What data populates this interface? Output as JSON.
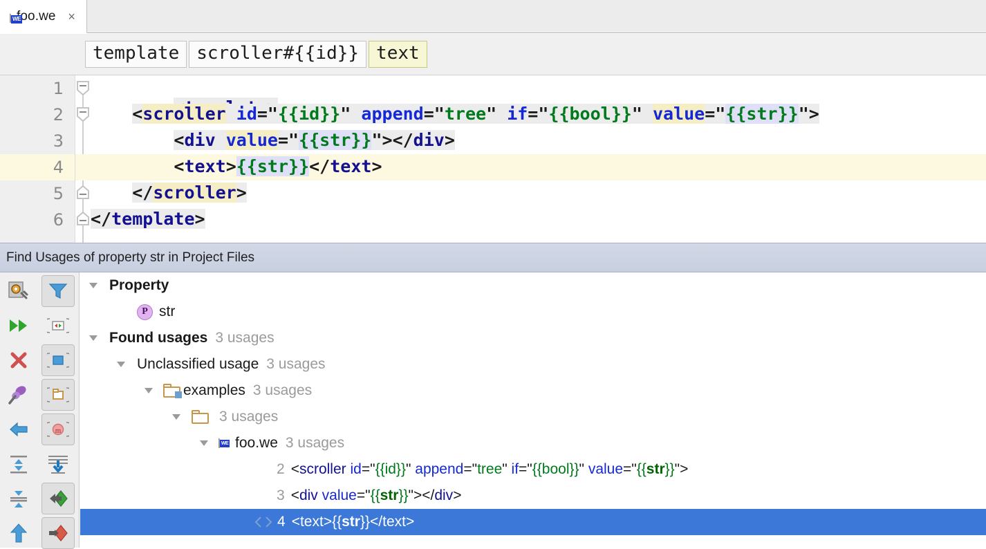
{
  "tab": {
    "filename": "foo.we",
    "close_label": "×",
    "file_icon": "we-file-icon"
  },
  "breadcrumbs": [
    {
      "label": "template",
      "highlighted": false
    },
    {
      "label": "scroller#{{id}}",
      "highlighted": false
    },
    {
      "label": "text",
      "highlighted": true
    }
  ],
  "editor": {
    "line_numbers": [
      "1",
      "2",
      "3",
      "4",
      "5",
      "6"
    ],
    "current_line": 4,
    "lines": [
      {
        "n": "1",
        "text": "<template>"
      },
      {
        "n": "2",
        "text": "    <scroller id=\"{{id}}\" append=\"tree\" if=\"{{bool}}\" value=\"{{str}}\">"
      },
      {
        "n": "3",
        "text": "        <div value=\"{{str}}\"></div>"
      },
      {
        "n": "4",
        "text": "        <text>{{str}}</text>"
      },
      {
        "n": "5",
        "text": "    </scroller>"
      },
      {
        "n": "6",
        "text": "</template>"
      }
    ],
    "seg": {
      "l1_open": "<",
      "l1_tag": "template",
      "l1_close": ">",
      "l2_indent": "    ",
      "l2_open": "<",
      "l2_tag": "scroller",
      "l2_sp1": " ",
      "l2_at1": "id",
      "l2_eq1": "=\"",
      "l2_v1": "{{id}}",
      "l2_q1": "\"",
      "l2_sp2": " ",
      "l2_at2": "append",
      "l2_eq2": "=\"",
      "l2_v2": "tree",
      "l2_q2": "\"",
      "l2_sp3": " ",
      "l2_at3": "if",
      "l2_eq3": "=\"",
      "l2_v3": "{{bool}}",
      "l2_q3": "\"",
      "l2_sp4": " ",
      "l2_at4": "value",
      "l2_eq4": "=\"",
      "l2_v4": "{{str}}",
      "l2_q4": "\"",
      "l2_gt": ">",
      "l3_indent": "        ",
      "l3_open": "<",
      "l3_tag": "div",
      "l3_sp": " ",
      "l3_at": "value",
      "l3_eq": "=\"",
      "l3_v": "{{str}}",
      "l3_q": "\"",
      "l3_gt": ">",
      "l3_closeopen": "</",
      "l3_ctag": "div",
      "l3_cgt": ">",
      "l4_indent": "        ",
      "l4_open": "<",
      "l4_tag": "text",
      "l4_gt": ">",
      "l4_v": "{{str}}",
      "l4_closeopen": "</",
      "l4_ctag": "text",
      "l4_cgt": ">",
      "l5_indent": "    ",
      "l5_open": "</",
      "l5_tag": "scroller",
      "l5_gt": ">",
      "l6_open": "</",
      "l6_tag": "template",
      "l6_gt": ">"
    }
  },
  "find_usages": {
    "title": "Find Usages of property str in Project Files"
  },
  "toolbar": {
    "buttons": [
      {
        "name": "settings-icon",
        "label": "Settings"
      },
      {
        "name": "filter-icon",
        "label": "Filter",
        "boxed": true
      },
      {
        "name": "rerun-icon",
        "label": "Rerun"
      },
      {
        "name": "preview-usages-icon",
        "label": "Preview Usages"
      },
      {
        "name": "close-icon",
        "label": "Close"
      },
      {
        "name": "group-by-module-icon",
        "label": "Group by Module",
        "boxed": true
      },
      {
        "name": "pin-icon",
        "label": "Pin Tab"
      },
      {
        "name": "group-by-directory-icon",
        "label": "Group by Directory",
        "boxed": true
      },
      {
        "name": "back-arrow-icon",
        "label": "Back"
      },
      {
        "name": "group-by-method-icon",
        "label": "Group by Method",
        "boxed": true
      },
      {
        "name": "expand-all-icon",
        "label": "Expand All"
      },
      {
        "name": "collapse-lines-icon",
        "label": "Collapse Lines"
      },
      {
        "name": "collapse-all-icon",
        "label": "Collapse All"
      },
      {
        "name": "previous-occurrence-icon",
        "label": "Previous Occurrence",
        "boxed": true
      },
      {
        "name": "scroll-up-icon",
        "label": "Scroll Up"
      },
      {
        "name": "next-occurrence-icon",
        "label": "Next Occurrence",
        "boxed": true
      }
    ]
  },
  "tree": {
    "nodes": [
      {
        "label": "Property",
        "count": "",
        "bold": true
      },
      {
        "label": "str",
        "count": "",
        "bold": false
      },
      {
        "label": "Found usages",
        "count": "3 usages",
        "bold": true
      },
      {
        "label": "Unclassified usage",
        "count": "3 usages",
        "bold": false
      },
      {
        "label": "examples",
        "count": "3 usages",
        "bold": false
      },
      {
        "label": "",
        "count": "3 usages",
        "bold": false
      },
      {
        "label": "foo.we",
        "count": "3 usages",
        "bold": false
      }
    ],
    "usages": [
      {
        "line": "2",
        "selected": false,
        "parts": [
          {
            "t": "<",
            "c": "pn"
          },
          {
            "t": "scroller",
            "c": "tag"
          },
          {
            "t": " ",
            "c": "pn"
          },
          {
            "t": "id",
            "c": "at"
          },
          {
            "t": "=\"",
            "c": "pn"
          },
          {
            "t": "{{id}}",
            "c": "st"
          },
          {
            "t": "\"",
            "c": "pn"
          },
          {
            "t": " ",
            "c": "pn"
          },
          {
            "t": "append",
            "c": "at"
          },
          {
            "t": "=\"",
            "c": "pn"
          },
          {
            "t": "tree",
            "c": "st"
          },
          {
            "t": "\"",
            "c": "pn"
          },
          {
            "t": " ",
            "c": "pn"
          },
          {
            "t": "if",
            "c": "at"
          },
          {
            "t": "=\"",
            "c": "pn"
          },
          {
            "t": "{{bool}}",
            "c": "st"
          },
          {
            "t": "\"",
            "c": "pn"
          },
          {
            "t": " ",
            "c": "pn"
          },
          {
            "t": "value",
            "c": "at"
          },
          {
            "t": "=\"",
            "c": "pn"
          },
          {
            "t": "{{",
            "c": "st"
          },
          {
            "t": "str",
            "c": "hit"
          },
          {
            "t": "}}",
            "c": "st"
          },
          {
            "t": "\"",
            "c": "pn"
          },
          {
            "t": ">",
            "c": "pn"
          }
        ]
      },
      {
        "line": "3",
        "selected": false,
        "parts": [
          {
            "t": "<",
            "c": "pn"
          },
          {
            "t": "div",
            "c": "tag"
          },
          {
            "t": " ",
            "c": "pn"
          },
          {
            "t": "value",
            "c": "at"
          },
          {
            "t": "=\"",
            "c": "pn"
          },
          {
            "t": "{{",
            "c": "st"
          },
          {
            "t": "str",
            "c": "hit"
          },
          {
            "t": "}}",
            "c": "st"
          },
          {
            "t": "\"",
            "c": "pn"
          },
          {
            "t": ">",
            "c": "pn"
          },
          {
            "t": "</",
            "c": "pn"
          },
          {
            "t": "div",
            "c": "tag"
          },
          {
            "t": ">",
            "c": "pn"
          }
        ]
      },
      {
        "line": "4",
        "selected": true,
        "parts": [
          {
            "t": "<",
            "c": "pn"
          },
          {
            "t": "text",
            "c": "tag"
          },
          {
            "t": ">",
            "c": "pn"
          },
          {
            "t": "{{",
            "c": "st"
          },
          {
            "t": "str",
            "c": "hit"
          },
          {
            "t": "}}",
            "c": "st"
          },
          {
            "t": "</",
            "c": "pn"
          },
          {
            "t": "text",
            "c": "tag"
          },
          {
            "t": ">",
            "c": "pn"
          }
        ]
      }
    ]
  },
  "colors": {
    "selection_blue": "#3c78d8",
    "header_blue": "#ccd3e3",
    "current_line": "#fdf9e0",
    "usage_lavender": "#dfdff7",
    "caret_yellow": "#f5edc4",
    "tag_navy": "#13118f",
    "attr_blue": "#1528d6",
    "string_green": "#007a1c"
  }
}
